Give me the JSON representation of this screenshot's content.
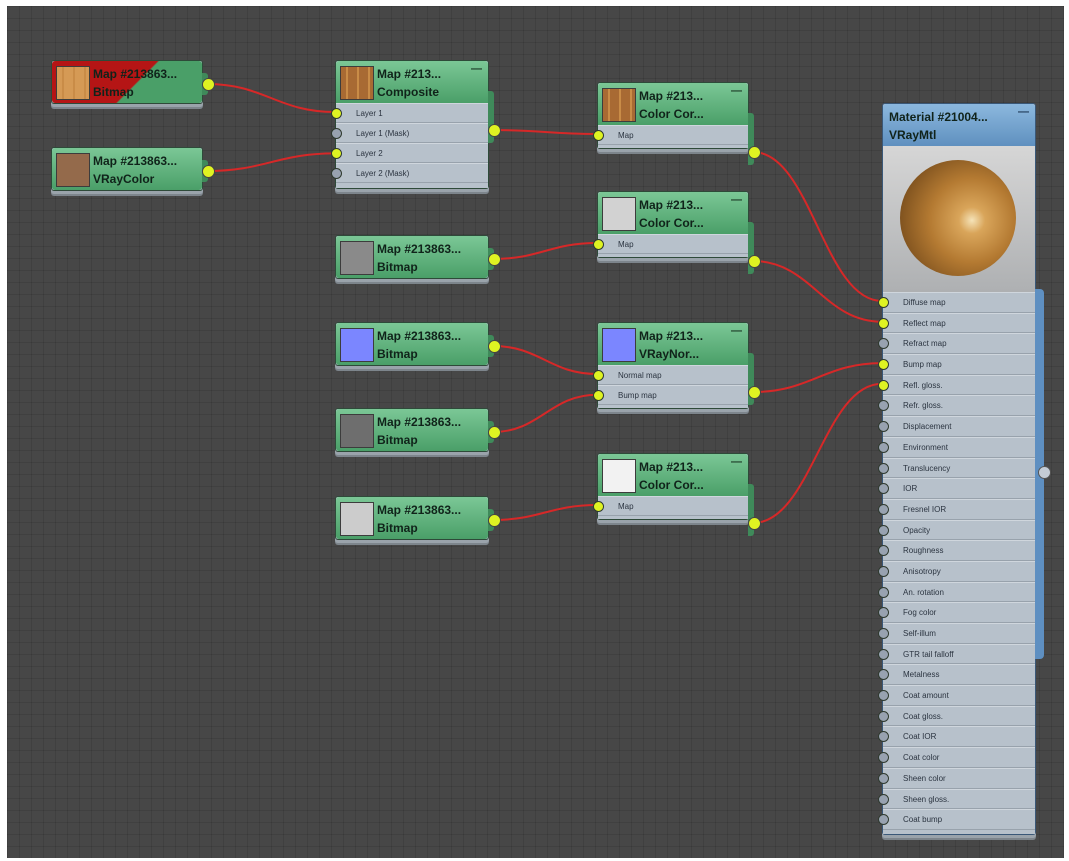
{
  "nodes": {
    "bitmap_wood": {
      "title": "Map #213863...",
      "type": "Bitmap",
      "swatch": "#d59a55",
      "header_color": "#b51515"
    },
    "vraycolor": {
      "title": "Map #213863...",
      "type": "VRayColor",
      "swatch": "#946a4b"
    },
    "composite": {
      "title": "Map #213...",
      "type": "Composite",
      "swatch": "#a86a33",
      "inputs": [
        {
          "label": "Layer 1",
          "connected": true
        },
        {
          "label": "Layer 1 (Mask)",
          "connected": false
        },
        {
          "label": "Layer 2",
          "connected": true
        },
        {
          "label": "Layer 2 (Mask)",
          "connected": false
        }
      ]
    },
    "colorcor1": {
      "title": "Map #213...",
      "type": "Color Cor...",
      "swatch": "#a86a33",
      "inputs": [
        {
          "label": "Map",
          "connected": true
        }
      ]
    },
    "bitmap_gray": {
      "title": "Map #213863...",
      "type": "Bitmap",
      "swatch": "#8a8a8a"
    },
    "colorcor2": {
      "title": "Map #213...",
      "type": "Color Cor...",
      "swatch": "#d2d2d2",
      "inputs": [
        {
          "label": "Map",
          "connected": true
        }
      ]
    },
    "bitmap_normal": {
      "title": "Map #213863...",
      "type": "Bitmap",
      "swatch": "#7b86ff"
    },
    "vraynormal": {
      "title": "Map #213...",
      "type": "VRayNor...",
      "swatch": "#7b86ff",
      "inputs": [
        {
          "label": "Normal map",
          "connected": true
        },
        {
          "label": "Bump map",
          "connected": true
        }
      ]
    },
    "bitmap_bump": {
      "title": "Map #213863...",
      "type": "Bitmap",
      "swatch": "#6e6e6e"
    },
    "bitmap_light": {
      "title": "Map #213863...",
      "type": "Bitmap",
      "swatch": "#cccccc"
    },
    "colorcor3": {
      "title": "Map #213...",
      "type": "Color Cor...",
      "swatch": "#f2f2f2",
      "inputs": [
        {
          "label": "Map",
          "connected": true
        }
      ]
    }
  },
  "material": {
    "title": "Material #21004...",
    "type": "VRayMtl",
    "inputs": [
      {
        "label": "Diffuse map",
        "connected": true
      },
      {
        "label": "Reflect map",
        "connected": true
      },
      {
        "label": "Refract map",
        "connected": false
      },
      {
        "label": "Bump map",
        "connected": true
      },
      {
        "label": "Refl. gloss.",
        "connected": true
      },
      {
        "label": "Refr. gloss.",
        "connected": false
      },
      {
        "label": "Displacement",
        "connected": false
      },
      {
        "label": "Environment",
        "connected": false
      },
      {
        "label": "Translucency",
        "connected": false
      },
      {
        "label": "IOR",
        "connected": false
      },
      {
        "label": "Fresnel IOR",
        "connected": false
      },
      {
        "label": "Opacity",
        "connected": false
      },
      {
        "label": "Roughness",
        "connected": false
      },
      {
        "label": "Anisotropy",
        "connected": false
      },
      {
        "label": "An. rotation",
        "connected": false
      },
      {
        "label": "Fog color",
        "connected": false
      },
      {
        "label": "Self-illum",
        "connected": false
      },
      {
        "label": "GTR tail falloff",
        "connected": false
      },
      {
        "label": "Metalness",
        "connected": false
      },
      {
        "label": "Coat amount",
        "connected": false
      },
      {
        "label": "Coat gloss.",
        "connected": false
      },
      {
        "label": "Coat IOR",
        "connected": false
      },
      {
        "label": "Coat color",
        "connected": false
      },
      {
        "label": "Sheen color",
        "connected": false
      },
      {
        "label": "Sheen gloss.",
        "connected": false
      },
      {
        "label": "Coat bump",
        "connected": false
      }
    ]
  },
  "icons": {
    "minimize": "minimize-icon",
    "socket": "socket-icon"
  },
  "colors": {
    "canvas": "#474747",
    "wire": "#d62828",
    "socket_active": "#dff322",
    "node_header": "#5fb07c",
    "material_header": "#6f9fcf"
  },
  "connections": [
    {
      "from": "bitmap_wood",
      "to": "composite",
      "input": 0
    },
    {
      "from": "vraycolor",
      "to": "composite",
      "input": 2
    },
    {
      "from": "composite",
      "to": "colorcor1",
      "input": 0
    },
    {
      "from": "bitmap_gray",
      "to": "colorcor2",
      "input": 0
    },
    {
      "from": "bitmap_normal",
      "to": "vraynormal",
      "input": 0
    },
    {
      "from": "bitmap_bump",
      "to": "vraynormal",
      "input": 1
    },
    {
      "from": "bitmap_light",
      "to": "colorcor3",
      "input": 0
    },
    {
      "from": "colorcor1",
      "to": "material",
      "input": 0
    },
    {
      "from": "colorcor2",
      "to": "material",
      "input": 1
    },
    {
      "from": "vraynormal",
      "to": "material",
      "input": 3
    },
    {
      "from": "colorcor3",
      "to": "material",
      "input": 4
    }
  ]
}
